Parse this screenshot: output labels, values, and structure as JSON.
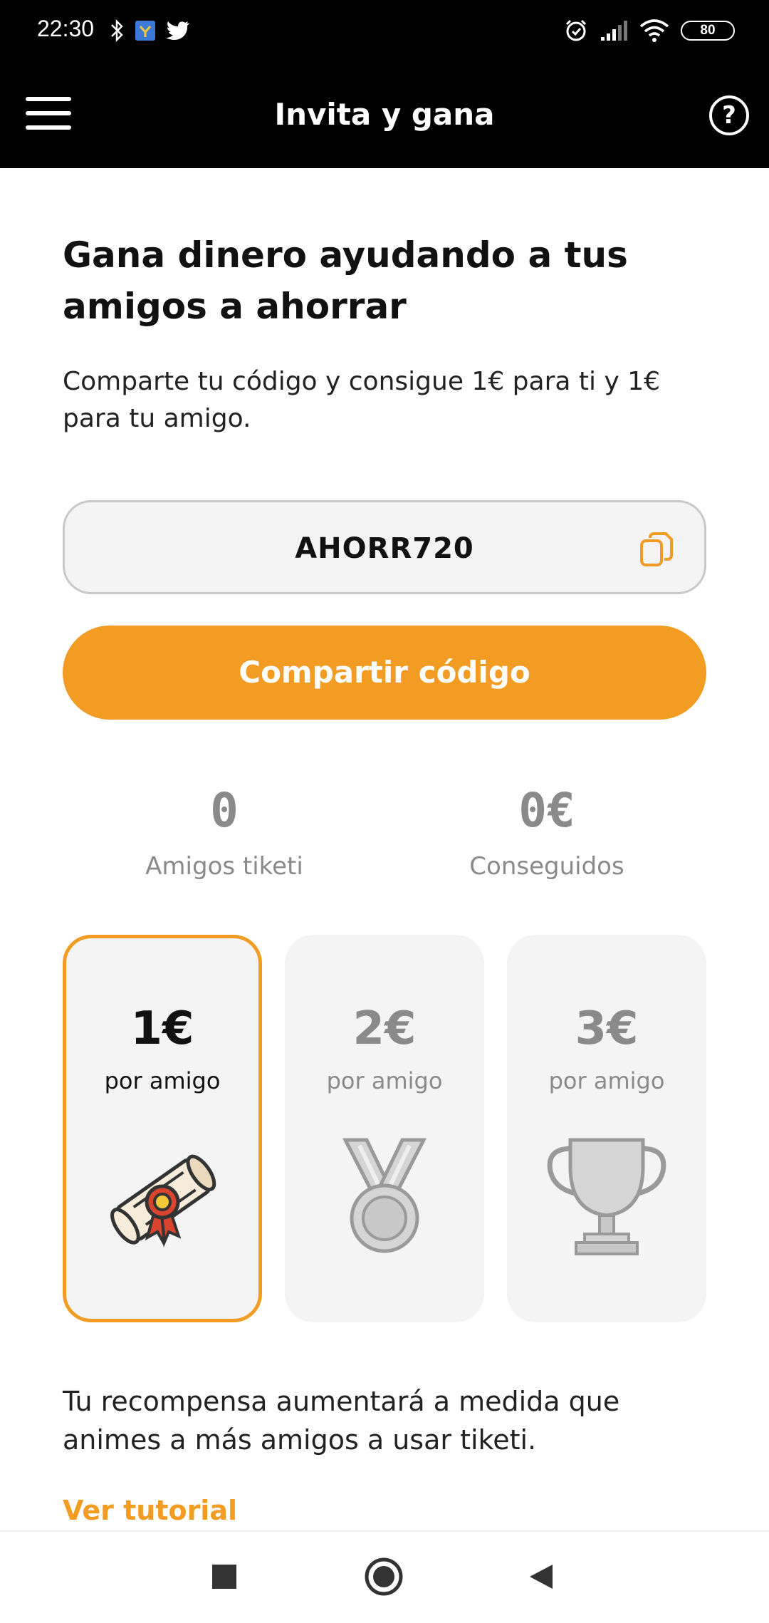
{
  "status_bar": {
    "time": "22:30",
    "battery": "80",
    "left_icons": [
      "bluetooth-icon",
      "app-notification-icon",
      "twitter-icon"
    ],
    "right_icons": [
      "alarm-icon",
      "signal-icon",
      "wifi-icon",
      "battery-icon"
    ]
  },
  "app_bar": {
    "title": "Invita y gana",
    "menu_icon": "hamburger-menu-icon",
    "help_icon": "help-icon",
    "help_glyph": "?"
  },
  "headline": "Gana dinero ayudando a tus amigos a ahorrar",
  "subtext": "Comparte tu código y consigue 1€ para ti y 1€ para tu amigo.",
  "referral": {
    "code": "AHORR720",
    "copy_icon": "copy-icon"
  },
  "share_button": "Compartir código",
  "stats": [
    {
      "value": "0",
      "label": "Amigos tiketi"
    },
    {
      "value": "0€",
      "label": "Conseguidos"
    }
  ],
  "tiers": [
    {
      "amount": "1€",
      "label": "por amigo",
      "icon": "diploma-scroll-icon",
      "active": true
    },
    {
      "amount": "2€",
      "label": "por amigo",
      "icon": "medal-icon",
      "active": false
    },
    {
      "amount": "3€",
      "label": "por amigo",
      "icon": "trophy-icon",
      "active": false
    }
  ],
  "footer_text": "Tu recompensa aumentará a medida que animes a más amigos a usar tiketi.",
  "tutorial_link": "Ver tutorial",
  "colors": {
    "accent": "#f39c24",
    "app_bar": "#000000",
    "muted": "#8a8a8a",
    "card_bg": "#f4f4f4"
  },
  "nav_bar": [
    "recent-apps-button",
    "home-button",
    "back-button"
  ]
}
